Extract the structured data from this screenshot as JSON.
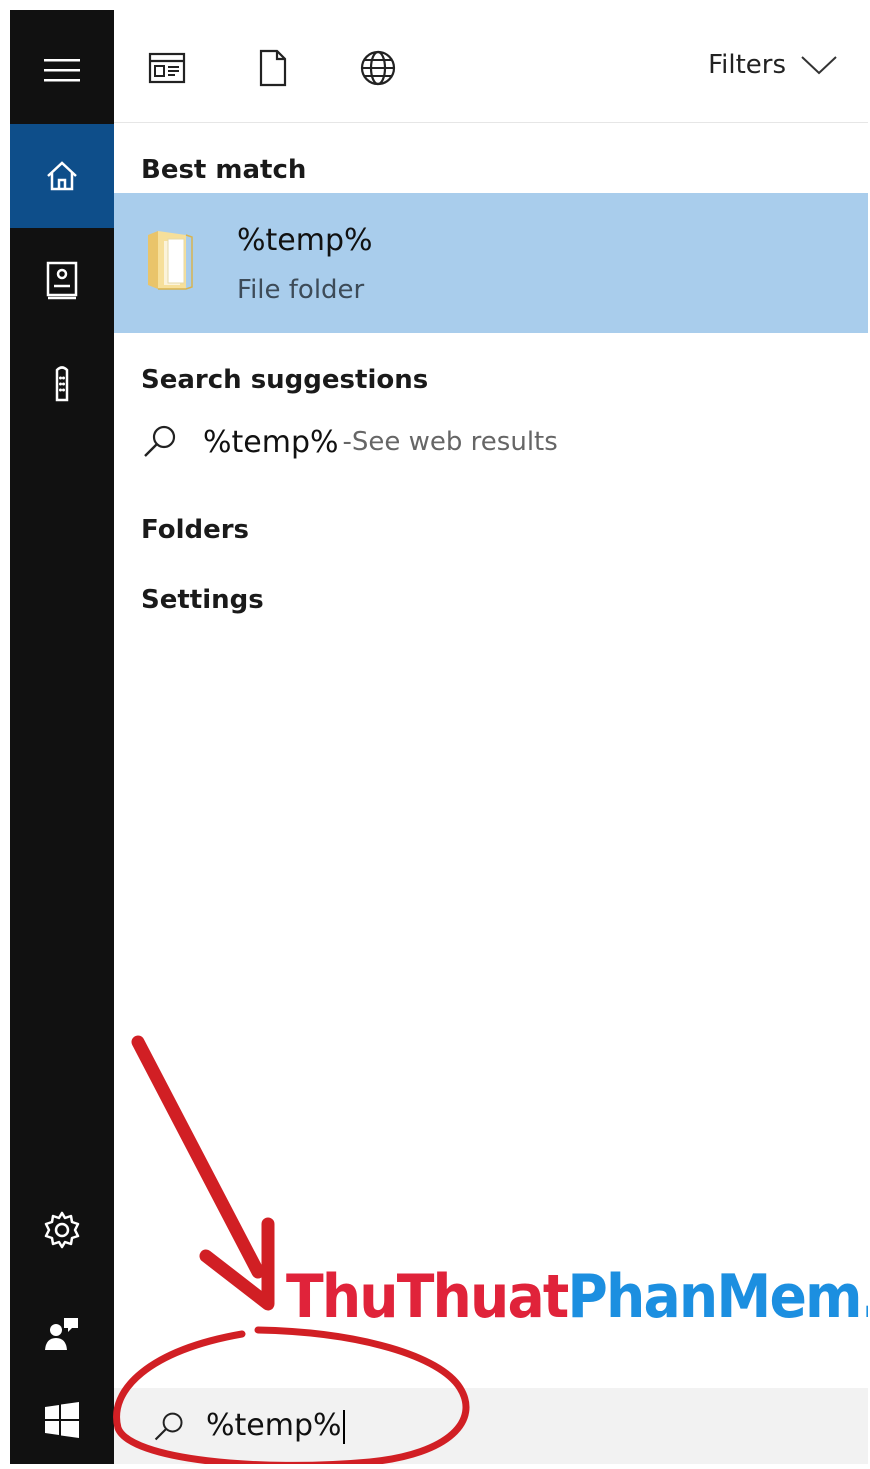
{
  "topbar": {
    "icons": [
      "apps-icon",
      "document-icon",
      "web-icon"
    ],
    "filters_label": "Filters"
  },
  "rail": {
    "items": [
      "menu-icon",
      "home-icon",
      "notebook-icon",
      "devices-icon",
      "settings-icon",
      "feedback-icon",
      "start-icon"
    ],
    "active": "home-icon",
    "active_color": "#0e4e8a",
    "background": "#111111"
  },
  "results": {
    "best_match_title": "Best match",
    "best_match": {
      "name": "%temp%",
      "type": "File folder",
      "highlight_color": "#a9cdec"
    },
    "suggestions_title": "Search suggestions",
    "suggestion": {
      "query": "%temp%",
      "separator": " - ",
      "hint": "See web results"
    },
    "folders_title": "Folders",
    "settings_title": "Settings"
  },
  "search": {
    "value": "%temp%"
  },
  "watermark": {
    "part1": "ThuThuat",
    "part2": "PhanMem.vn",
    "color1": "#e0233a",
    "color2": "#1c8fe0"
  },
  "annotation": {
    "color": "#d11f24"
  }
}
